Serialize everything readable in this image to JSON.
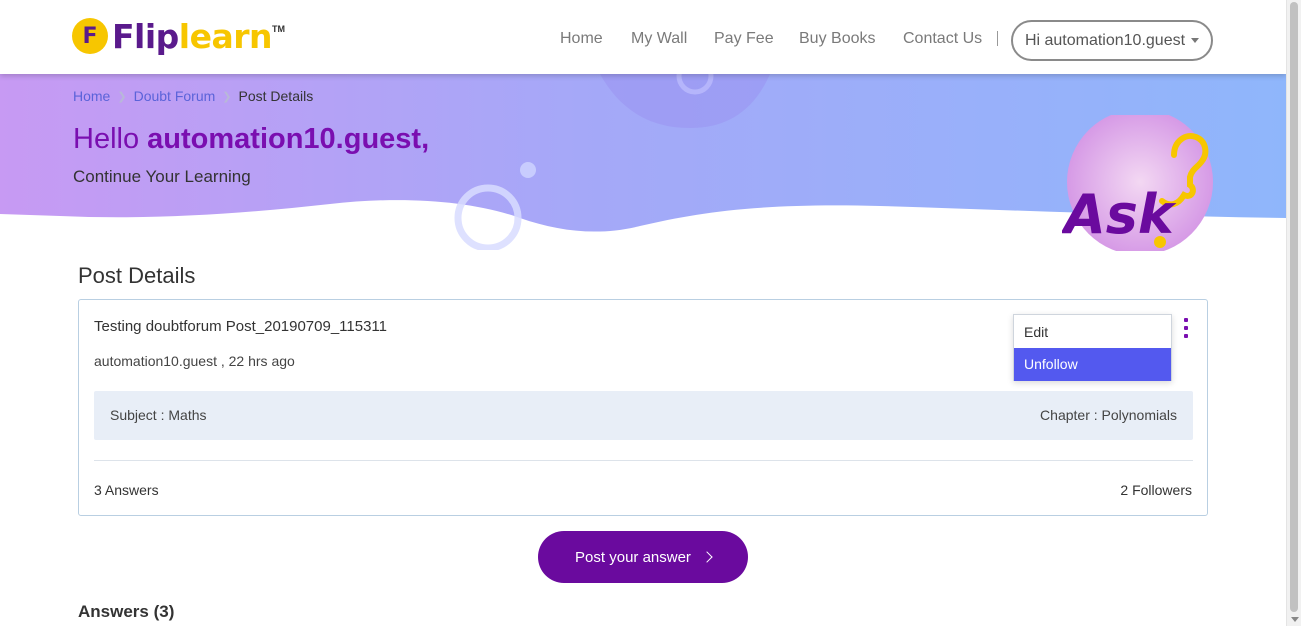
{
  "logo": {
    "badge_letter": "F",
    "part1": "Flip",
    "part2": "learn",
    "tm": "TM"
  },
  "nav": {
    "items": [
      {
        "label": "Home"
      },
      {
        "label": "My Wall"
      },
      {
        "label": "Pay Fee"
      },
      {
        "label": "Buy Books"
      },
      {
        "label": "Contact Us"
      }
    ],
    "user_label": "Hi automation10.guest"
  },
  "breadcrumb": {
    "home": "Home",
    "forum": "Doubt Forum",
    "current": "Post Details"
  },
  "hero": {
    "hello_prefix": "Hello ",
    "hello_name": "automation10.guest,",
    "subtitle": "Continue Your Learning",
    "ask_text": "Ask"
  },
  "post": {
    "section_title": "Post Details",
    "title": "Testing doubtforum Post_20190709_115311",
    "meta": "automation10.guest , 22 hrs ago",
    "subject": "Subject : Maths",
    "chapter": "Chapter : Polynomials",
    "answers_count": "3 Answers",
    "followers": "2 Followers"
  },
  "menu": {
    "edit": "Edit",
    "unfollow": "Unfollow"
  },
  "post_answer_label": "Post your answer",
  "answers_heading": "Answers (3)",
  "colors": {
    "brand_purple": "#6a0a9e",
    "brand_yellow": "#f7c600",
    "highlight_blue": "#5359ef",
    "link_blue": "#5b63d9"
  }
}
